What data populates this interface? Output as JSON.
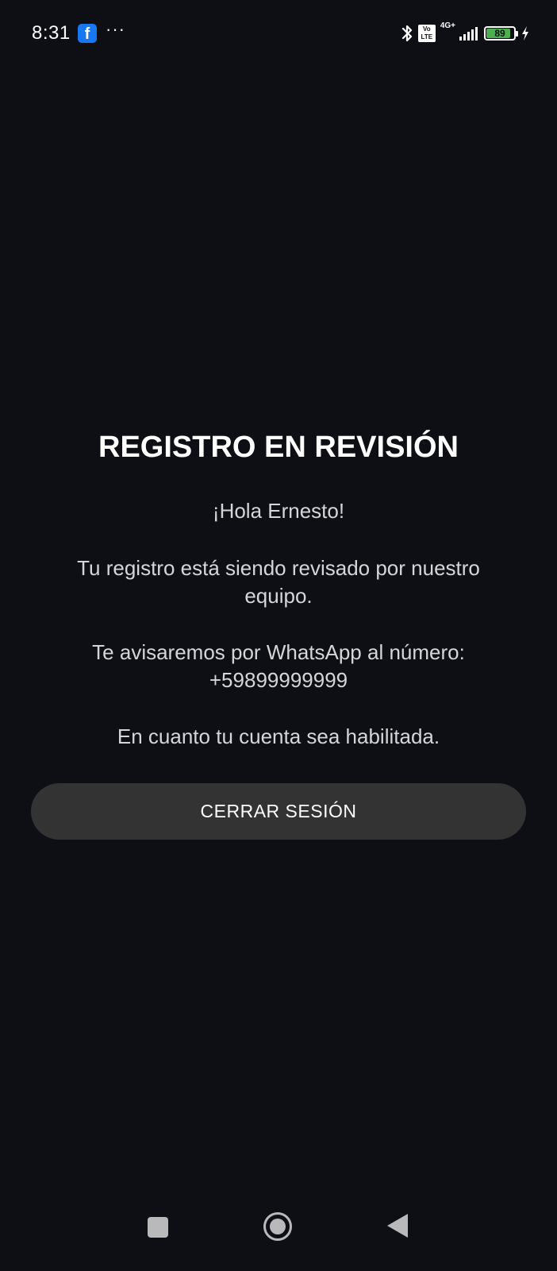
{
  "status_bar": {
    "time": "8:31",
    "notification_icons": [
      "facebook-icon",
      "more-dots-icon"
    ],
    "more_dots": "···",
    "system_icons": [
      "bluetooth-icon",
      "volte-icon",
      "signal-icon",
      "battery-icon",
      "charging-icon"
    ],
    "volte_top": "Vo",
    "volte_bottom": "LTE",
    "network": "4G+",
    "battery_level": "89",
    "battery_percent": 89,
    "battery_color": "#4caf50"
  },
  "main": {
    "title": "REGISTRO EN REVISIÓN",
    "greeting": "¡Hola Ernesto!",
    "review_message": "Tu registro está siendo revisado por nuestro equipo.",
    "whatsapp_message": "Te avisaremos por WhatsApp al número:",
    "phone_number": "+59899999999",
    "enabled_message": "En cuanto tu cuenta sea habilitada.",
    "logout_label": "CERRAR SESIÓN"
  },
  "nav_bar": {
    "buttons": [
      "recents-square-icon",
      "home-circle-icon",
      "back-triangle-icon"
    ]
  },
  "colors": {
    "background": "#0d0f15",
    "button_background": "#333333",
    "text_primary": "#ffffff",
    "text_secondary": "#d6d6d8"
  }
}
